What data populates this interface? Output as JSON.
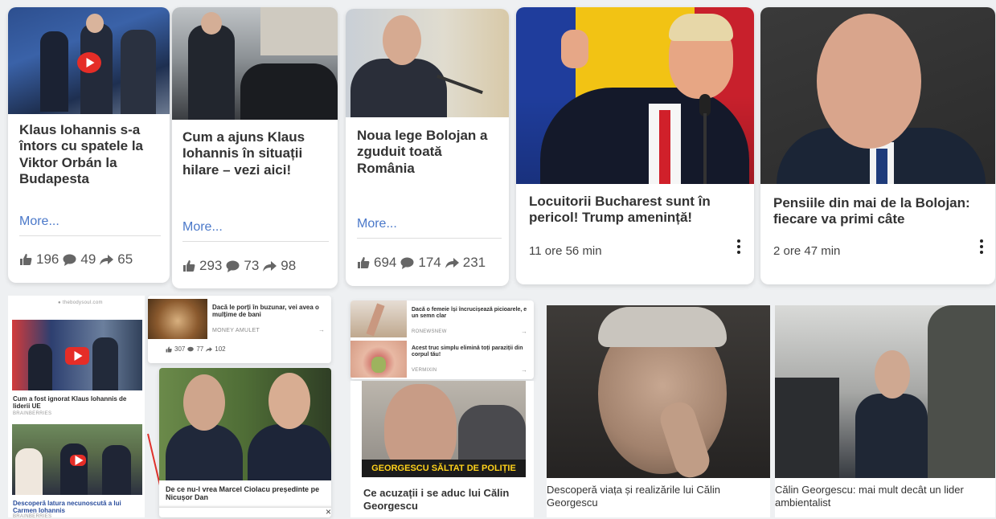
{
  "top_cards": [
    {
      "title": "Klaus Iohannis s-a întors cu spatele la Viktor Orbán la Budapesta",
      "more": "More...",
      "likes": "196",
      "comments": "49",
      "shares": "65"
    },
    {
      "title": "Cum a ajuns Klaus Iohannis în situații hilare – vezi aici!",
      "more": "More...",
      "likes": "293",
      "comments": "73",
      "shares": "98"
    },
    {
      "title": "Noua lege Bolojan a zguduit toată România",
      "more": "More...",
      "likes": "694",
      "comments": "174",
      "shares": "231"
    }
  ],
  "big_cards": [
    {
      "title": "Locuitorii Bucharest sunt în pericol! Trump amenință!",
      "time": "11 ore 56 min"
    },
    {
      "title": "Pensiile din mai de la Bolojan: fiecare va primi câte",
      "time": "2 ore 47 min"
    }
  ],
  "ad_col1": {
    "source": "● thebodysoul.com",
    "item1": {
      "title": "Cum a fost ignorat Klaus Iohannis de liderii UE",
      "brand": "BRAINBERRIES"
    },
    "item2": {
      "title": "Descoperă latura necunoscută a lui Carmen Iohannis",
      "brand": "BRAINBERRIES"
    }
  },
  "ad_col2": {
    "item1": {
      "title": "Dacă le porți în buzunar, vei avea o mulțime de bani",
      "brand": "MONEY AMULET",
      "arrow": "→"
    },
    "stats": {
      "likes": "307",
      "comments": "77",
      "shares": "102"
    },
    "item2": {
      "title": "De ce nu-l vrea Marcel Ciolacu președinte pe Nicușor Dan"
    },
    "close": "×"
  },
  "ad_col3": {
    "item1": {
      "title": "Dacă o femeie își încrucișează picioarele, e un semn clar",
      "brand": "RONEWSNEW",
      "arrow": "→"
    },
    "item2": {
      "title": "Acest truc simplu elimină toți paraziții din corpul tău!",
      "brand": "VERMIXIN",
      "arrow": "→"
    },
    "banner": "GEORGESCU SĂLTAT DE POLIȚIE",
    "caption": "Ce acuzații i se aduc lui Călin Georgescu"
  },
  "bottom_cards": [
    {
      "title": "Descoperă viața și realizările lui Călin Georgescu"
    },
    {
      "title": "Călin Georgescu: mai mult decât un lider ambientalist"
    }
  ],
  "colors": {
    "more_link": "#4a78c9",
    "play": "#e52d27",
    "banner_text": "#ffd21a"
  }
}
